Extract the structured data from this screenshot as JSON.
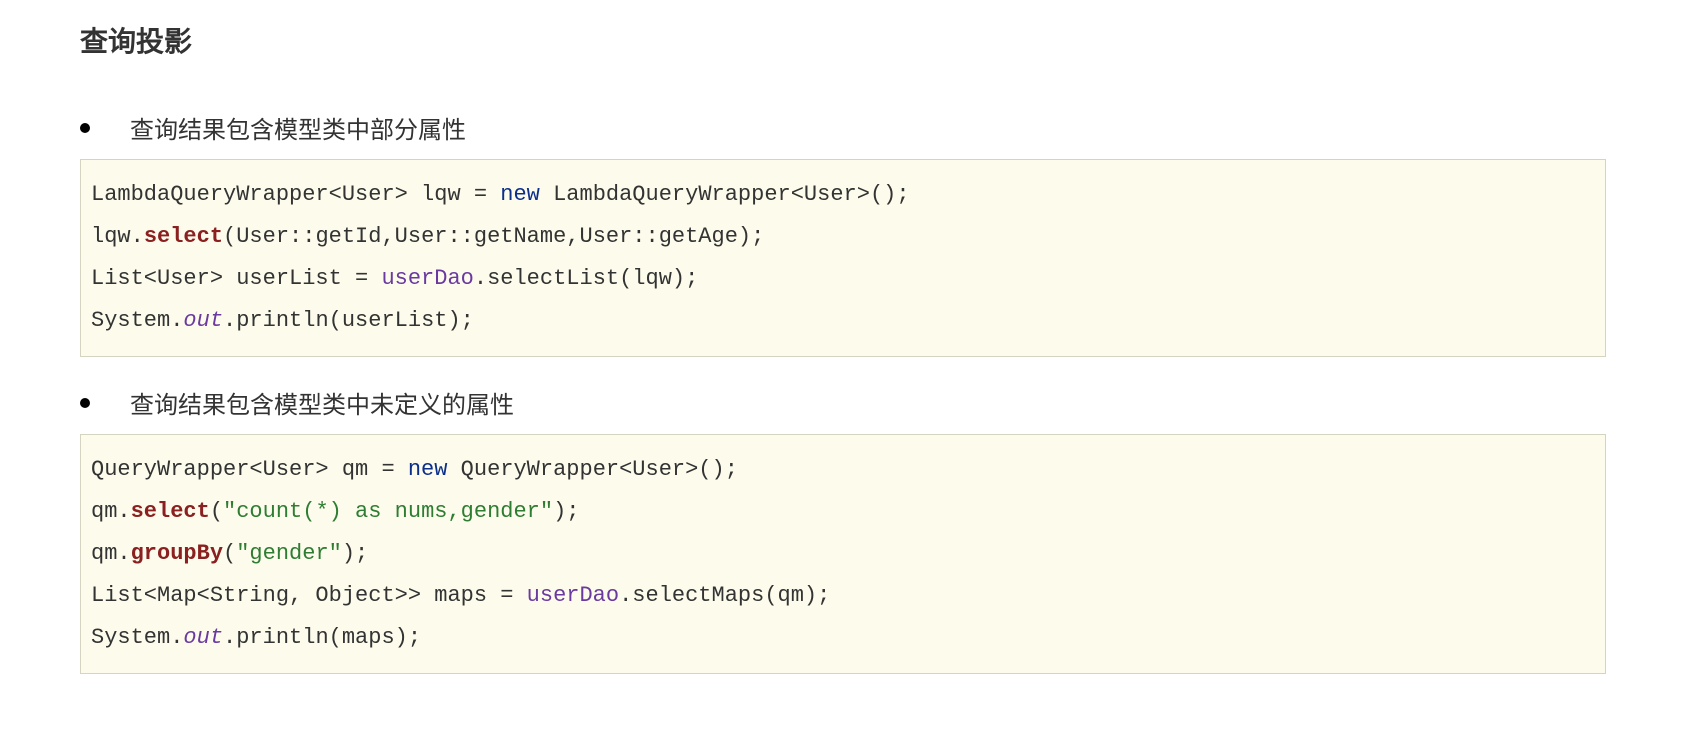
{
  "heading": "查询投影",
  "bullets": [
    "查询结果包含模型类中部分属性",
    "查询结果包含模型类中未定义的属性"
  ],
  "code1": {
    "l1a": "LambdaQueryWrapper<User> lqw = ",
    "l1_new": "new",
    "l1b": " LambdaQueryWrapper<User>();",
    "l2a": "lqw.",
    "l2_sel": "select",
    "l2b": "(User::getId,User::getName,User::getAge);",
    "l3a": "List<User> userList = ",
    "l3_dao": "userDao",
    "l3b": ".selectList(lqw);",
    "l4a": "System.",
    "l4_out": "out",
    "l4b": ".println(userList);"
  },
  "code2": {
    "l1a": "QueryWrapper<User> qm = ",
    "l1_new": "new",
    "l1b": " QueryWrapper<User>();",
    "l2a": "qm.",
    "l2_sel": "select",
    "l2b": "(",
    "l2_str": "\"count(*) as nums,gender\"",
    "l2c": ");",
    "l3a": "qm.",
    "l3_grp": "groupBy",
    "l3b": "(",
    "l3_str": "\"gender\"",
    "l3c": ");",
    "l4a": "List<Map<String, Object>> maps = ",
    "l4_dao": "userDao",
    "l4b": ".selectMaps(qm);",
    "l5a": "System.",
    "l5_out": "out",
    "l5b": ".println(maps);"
  }
}
